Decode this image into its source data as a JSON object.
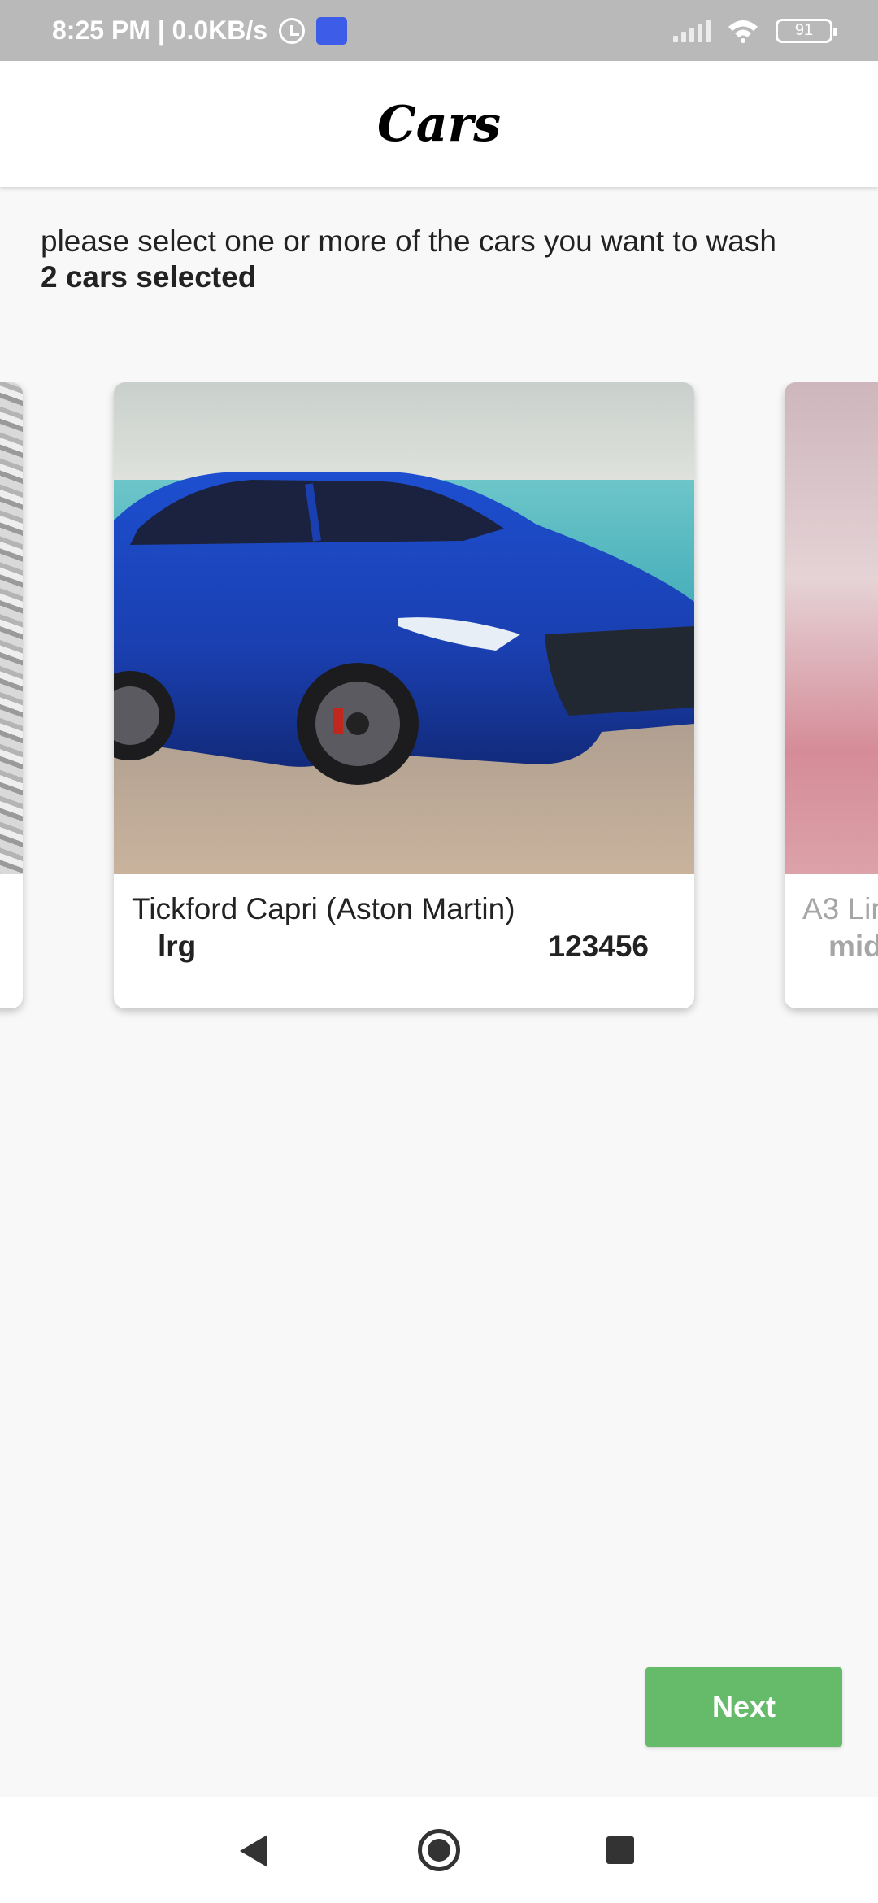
{
  "status_bar": {
    "time_speed": "8:25 PM | 0.0KB/s",
    "battery": "91",
    "icons": [
      "alarm-icon",
      "app-notification-icon",
      "signal-icon",
      "wifi-icon",
      "battery-icon"
    ]
  },
  "header": {
    "title": "Cars"
  },
  "instruction": {
    "text": "please select one or more of the cars you want to wash",
    "selected": "2 cars selected"
  },
  "cars": [
    {
      "name": "",
      "size": "",
      "plate": ""
    },
    {
      "name": "Tickford Capri (Aston Martin)",
      "size": "lrg",
      "plate": "123456"
    },
    {
      "name": "A3 Lir",
      "size": "mid",
      "plate": ""
    }
  ],
  "actions": {
    "next_label": "Next"
  },
  "nav": {
    "icons": [
      "back-icon",
      "home-icon",
      "recents-icon"
    ]
  },
  "colors": {
    "accent": "#66bb6a",
    "status_bar": "#b9b9b9"
  }
}
